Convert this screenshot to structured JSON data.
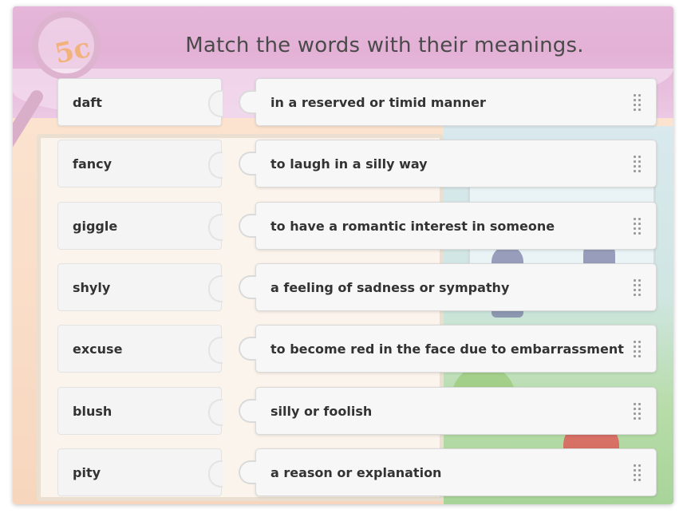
{
  "title": "Match the words with their meanings.",
  "badge": "5c",
  "words": [
    {
      "label": "daft"
    },
    {
      "label": "fancy"
    },
    {
      "label": "giggle"
    },
    {
      "label": "shyly"
    },
    {
      "label": "excuse"
    },
    {
      "label": "blush"
    },
    {
      "label": "pity"
    }
  ],
  "definitions": [
    {
      "label": "in a reserved or timid manner"
    },
    {
      "label": "to laugh in a silly way"
    },
    {
      "label": "to have a romantic interest in someone"
    },
    {
      "label": "a feeling of sadness or sympathy"
    },
    {
      "label": "to become red in the face due to embarrassment"
    },
    {
      "label": "silly or foolish"
    },
    {
      "label": "a reason or explanation"
    }
  ],
  "icons": {
    "drag_handle": "drag-grip-icon"
  },
  "colors": {
    "header_bg": "#e3b1d6",
    "card_bg": "#f4f4f4",
    "text": "#333333",
    "title": "#4a4a4a"
  }
}
